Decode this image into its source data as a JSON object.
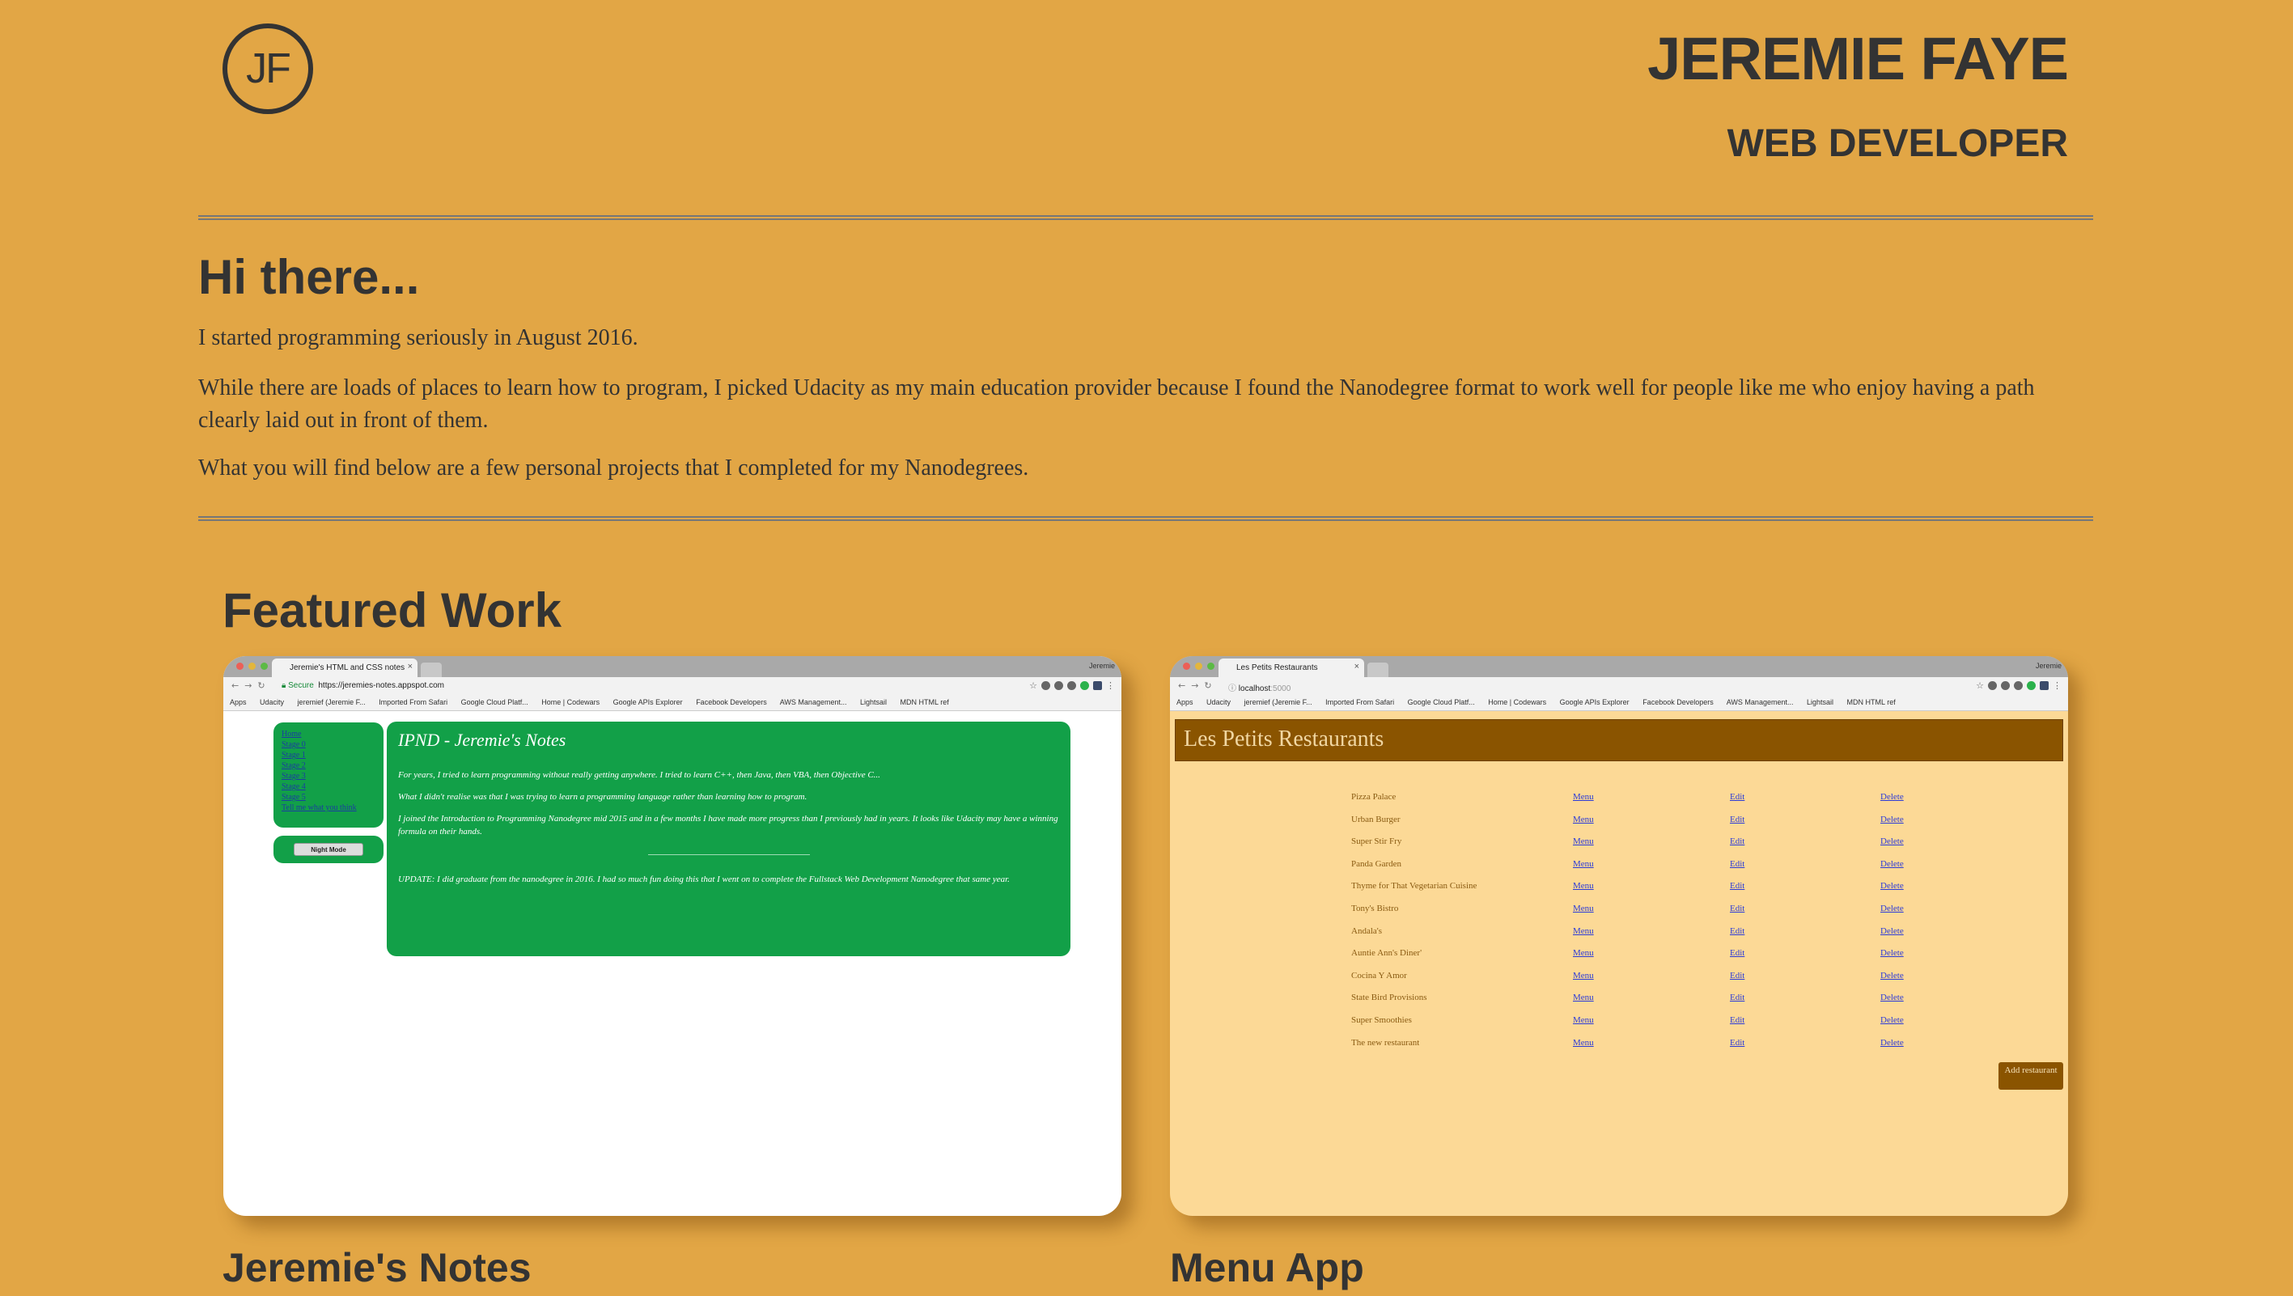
{
  "header": {
    "logo": "JF",
    "name": "JEREMIE FAYE",
    "role": "WEB DEVELOPER"
  },
  "intro": {
    "title": "Hi there...",
    "paragraphs": [
      "I started programming seriously in August 2016.",
      "While there are loads of places to learn how to program, I picked Udacity as my main education provider because I found the Nanodegree format to work well for people like me who enjoy having a path clearly laid out in front of them.",
      "What you will find below are a few personal projects that I completed for my Nanodegrees."
    ]
  },
  "featured": {
    "title": "Featured Work",
    "projects": [
      {
        "title": "Jeremie's Notes",
        "browser": {
          "tab": "Jeremie's HTML and CSS notes",
          "user": "Jeremie",
          "secure_label": "Secure",
          "url": "https://jeremies-notes.appspot.com",
          "bookmarks": [
            "Apps",
            "Udacity",
            "jeremief (Jeremie F...",
            "Imported From Safari",
            "Google Cloud Platf...",
            "Home | Codewars",
            "Google APIs Explorer",
            "Facebook Developers",
            "AWS Management...",
            "Lightsail",
            "MDN HTML ref"
          ]
        },
        "sidebar_links": [
          "Home",
          "Stage 0",
          "Stage 1",
          "Stage 2",
          "Stage 3",
          "Stage 4",
          "Stage 5",
          "Tell me what you think"
        ],
        "night_mode": "Night Mode",
        "heading": "IPND - Jeremie's Notes",
        "paragraphs": [
          "For years, I tried to learn programming without really getting anywhere. I tried to learn C++, then Java, then VBA, then Objective C...",
          "What I didn't realise was that I was trying to learn a programming language rather than learning how to program.",
          "I joined the Introduction to Programming Nanodegree mid 2015 and in a few months I have made more progress than I previously had in years. It looks like Udacity may have a winning formula on their hands."
        ],
        "update": "UPDATE: I did graduate from the nanodegree in 2016. I had so much fun doing this that I went on to complete the Fullstack Web Development Nanodegree that same year."
      },
      {
        "title": "Menu App",
        "browser": {
          "tab": "Les Petits Restaurants",
          "user": "Jeremie",
          "url_host": "localhost",
          "url_port": ":5000",
          "bookmarks": [
            "Apps",
            "Udacity",
            "jeremief (Jeremie F...",
            "Imported From Safari",
            "Google Cloud Platf...",
            "Home | Codewars",
            "Google APIs Explorer",
            "Facebook Developers",
            "AWS Management...",
            "Lightsail",
            "MDN HTML ref"
          ]
        },
        "app_title": "Les Petits Restaurants",
        "link_labels": {
          "menu": "Menu",
          "edit": "Edit",
          "delete": "Delete"
        },
        "restaurants": [
          "Pizza Palace",
          "Urban Burger",
          "Super Stir Fry",
          "Panda Garden",
          "Thyme for That Vegetarian Cuisine",
          "Tony's Bistro",
          "Andala's",
          "Auntie Ann's Diner'",
          "Cocina Y Amor",
          "State Bird Provisions",
          "Super Smoothies",
          "The new restaurant"
        ],
        "add_button": "Add restaurant"
      }
    ]
  },
  "colors": {
    "background": "#e2a645",
    "text": "#333333",
    "notes_green": "#12a048",
    "menu_brown": "#8a5400",
    "menu_cream": "#fcd996"
  }
}
